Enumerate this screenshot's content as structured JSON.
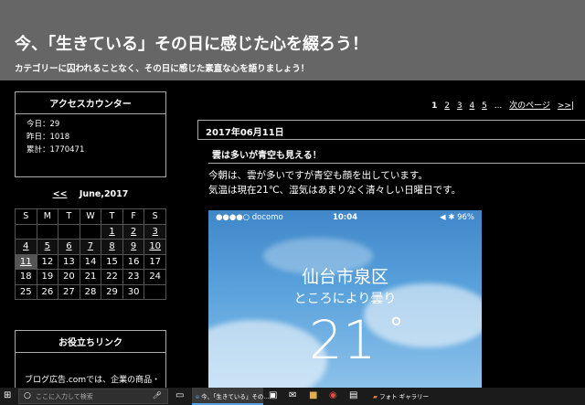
{
  "header": {
    "title": "今、「生きている」その日に感じた心を綴ろう！",
    "subtitle": "カテゴリーに囚われることなく、その日に感じた素直な心を語りましょう！"
  },
  "counter": {
    "title": "アクセスカウンター",
    "today": "今日：29",
    "yesterday": "昨日：1018",
    "total": "累計：1770471"
  },
  "calendar": {
    "prev": "<<",
    "month": "June,2017",
    "weekdays": [
      "S",
      "M",
      "T",
      "W",
      "T",
      "F",
      "S"
    ],
    "weeks": [
      [
        "",
        "",
        "",
        "",
        "1",
        "2",
        "3"
      ],
      [
        "4",
        "5",
        "6",
        "7",
        "8",
        "9",
        "10"
      ],
      [
        "11",
        "12",
        "13",
        "14",
        "15",
        "16",
        "17"
      ],
      [
        "18",
        "19",
        "20",
        "21",
        "22",
        "23",
        "24"
      ],
      [
        "25",
        "26",
        "27",
        "28",
        "29",
        "30",
        ""
      ]
    ]
  },
  "links": {
    "title": "お役立ちリンク",
    "text": "ブログ広告.comでは、企業の商品・"
  },
  "pager": {
    "current": "1",
    "pages": [
      "2",
      "3",
      "4",
      "5"
    ],
    "ellipsis": "...",
    "next": "次のページ",
    "last": ">>|"
  },
  "entry": {
    "date": "2017年06月11日",
    "title": "雲は多いが青空も見える！",
    "line1": "今朝は、雲が多いですが青空も顔を出しています。",
    "line2": "気温は現在21℃、湿気はあまりなく清々しい日曜日です。"
  },
  "phone": {
    "carrier": "●●●●○ docomo",
    "time": "10:04",
    "battery": "◀ ✱ 96%",
    "city": "仙台市泉区",
    "condition": "ところにより曇り",
    "temp": "21",
    "deg": "°"
  },
  "taskbar": {
    "search_placeholder": "ここに入力して検索",
    "app1": "今、「生きている」その...",
    "app2": "フォト ギャラリー"
  }
}
